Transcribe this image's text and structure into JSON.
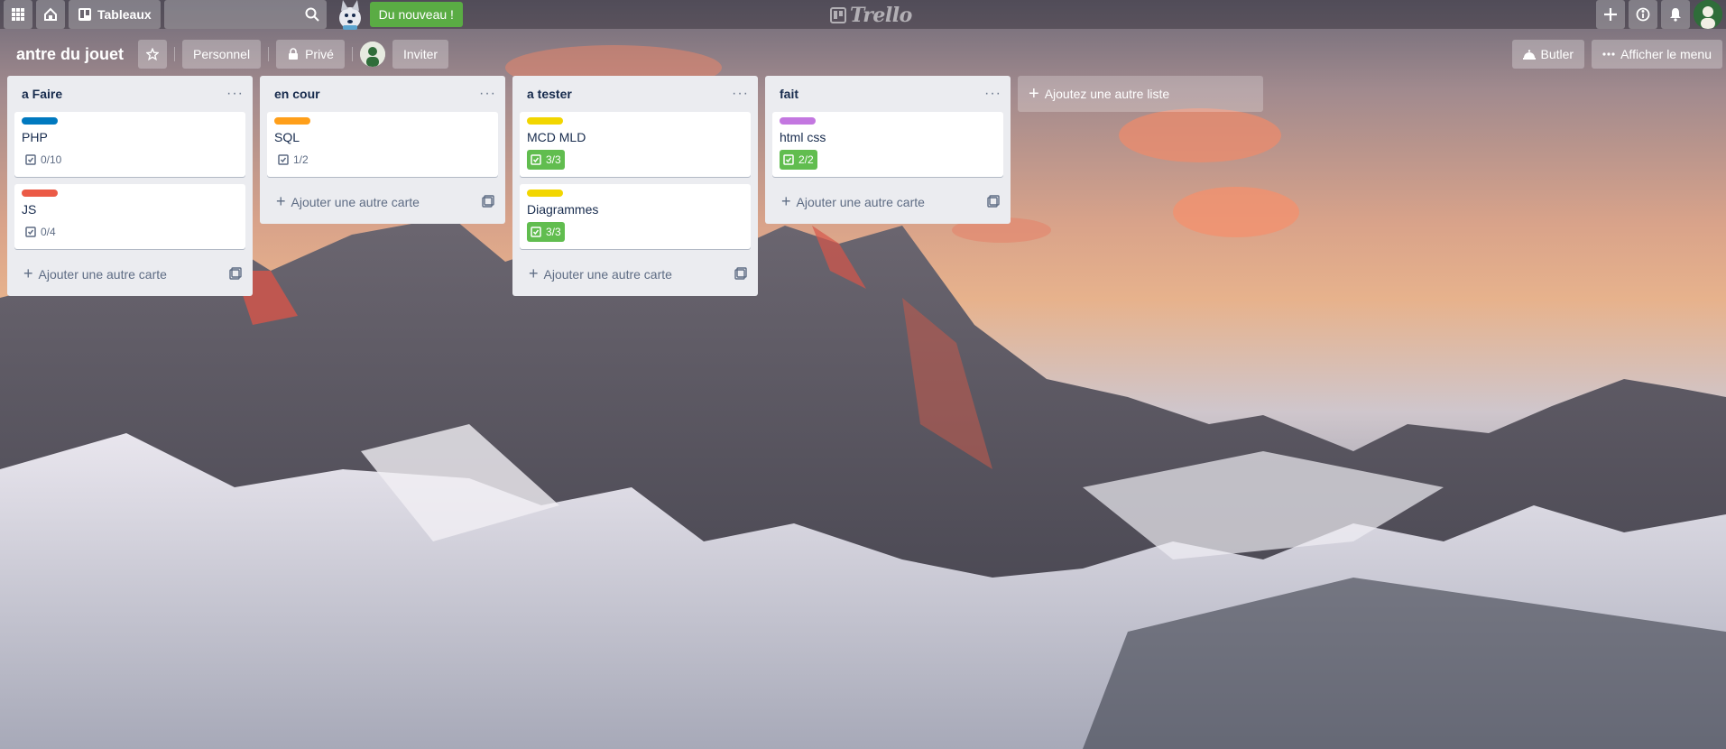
{
  "header": {
    "boards_label": "Tableaux",
    "search_value": "",
    "new_label": "Du nouveau !",
    "logo_text": "Trello"
  },
  "board": {
    "title": "antre du jouet",
    "team_label": "Personnel",
    "visibility_label": "Privé",
    "invite_label": "Inviter",
    "butler_label": "Butler",
    "menu_label": "Afficher le menu"
  },
  "lists": [
    {
      "title": "a Faire",
      "cards": [
        {
          "label_color": "#0079bf",
          "title": "PHP",
          "checklist": "0/10",
          "complete": false
        },
        {
          "label_color": "#eb5a46",
          "title": "JS",
          "checklist": "0/4",
          "complete": false
        }
      ]
    },
    {
      "title": "en cour",
      "cards": [
        {
          "label_color": "#ff9f1a",
          "title": "SQL",
          "checklist": "1/2",
          "complete": false
        }
      ]
    },
    {
      "title": "a tester",
      "cards": [
        {
          "label_color": "#f2d600",
          "title": "MCD MLD",
          "checklist": "3/3",
          "complete": true
        },
        {
          "label_color": "#f2d600",
          "title": "Diagrammes",
          "checklist": "3/3",
          "complete": true
        }
      ]
    },
    {
      "title": "fait",
      "cards": [
        {
          "label_color": "#c377e0",
          "title": "html css",
          "checklist": "2/2",
          "complete": true
        }
      ]
    }
  ],
  "add_card_label": "Ajouter une autre carte",
  "add_list_label": "Ajoutez une autre liste",
  "icons": {
    "apps": "grid-icon",
    "home": "home-icon",
    "boards": "boards-icon",
    "search": "search-icon",
    "create": "plus-icon",
    "info": "info-icon",
    "notifications": "bell-icon",
    "star": "star-icon",
    "lock": "lock-icon",
    "butler": "butler-icon",
    "menu": "ellipsis-icon",
    "checklist": "checkbox-icon",
    "template": "card-template-icon"
  },
  "colors": {
    "new_button": "#5aac44",
    "checklist_done": "#61bd4f",
    "list_bg": "#ebecf0"
  }
}
